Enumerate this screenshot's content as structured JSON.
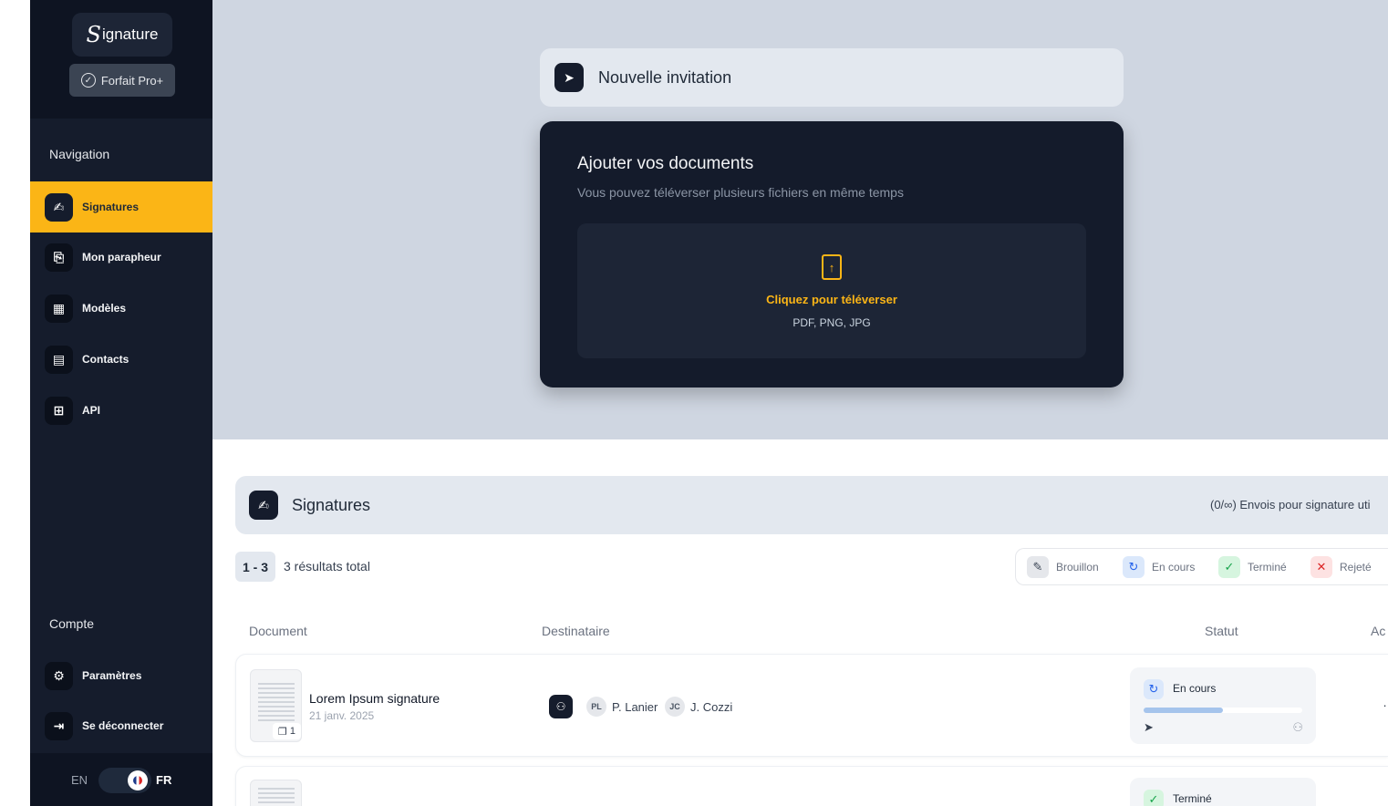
{
  "sidebar": {
    "logo": {
      "initial": "S",
      "rest": "ignature"
    },
    "plan": "Forfait Pro+",
    "navigation_title": "Navigation",
    "nav_items": [
      {
        "label": "Signatures",
        "icon": "signature-icon",
        "glyph": "✍"
      },
      {
        "label": "Mon parapheur",
        "icon": "parapheur-icon",
        "glyph": "⎘"
      },
      {
        "label": "Modèles",
        "icon": "templates-icon",
        "glyph": "▦"
      },
      {
        "label": "Contacts",
        "icon": "contacts-icon",
        "glyph": "▤"
      },
      {
        "label": "API",
        "icon": "api-icon",
        "glyph": "⊞"
      }
    ],
    "account_title": "Compte",
    "account_items": [
      {
        "label": "Paramètres",
        "icon": "gear-icon",
        "glyph": "⚙"
      },
      {
        "label": "Se déconnecter",
        "icon": "logout-icon",
        "glyph": "⇥"
      }
    ],
    "lang": {
      "left": "EN",
      "right": "FR",
      "active": "FR"
    }
  },
  "invite": {
    "title": "Nouvelle invitation",
    "upload_title": "Ajouter vos documents",
    "upload_subtitle": "Vous pouvez téléverser plusieurs fichiers en même temps",
    "dropzone_cta": "Cliquez pour téléverser",
    "dropzone_types": "PDF, PNG, JPG"
  },
  "signatures": {
    "title": "Signatures",
    "quota": "(0/∞) Envois pour signature uti",
    "range": "1 - 3",
    "results_total": "3 résultats total",
    "filters": [
      {
        "label": "Brouillon",
        "color": "#e5e7eb",
        "fg": "#374151",
        "glyph": "✎"
      },
      {
        "label": "En cours",
        "color": "#dbe8fb",
        "fg": "#2563eb",
        "glyph": "↻"
      },
      {
        "label": "Terminé",
        "color": "#d6f5df",
        "fg": "#16a34a",
        "glyph": "✓"
      },
      {
        "label": "Rejeté",
        "color": "#fde2e2",
        "fg": "#dc2626",
        "glyph": "✕"
      }
    ],
    "columns": {
      "document": "Document",
      "recipient": "Destinataire",
      "status": "Statut",
      "actions": "Ac"
    },
    "rows": [
      {
        "name": "Lorem Ipsum signature",
        "date": "21 janv. 2025",
        "doc_count": "1",
        "recipients": [
          {
            "initials": "PL",
            "name": "P. Lanier"
          },
          {
            "initials": "JC",
            "name": "J. Cozzi"
          }
        ],
        "status": "En cours",
        "progress": 0.5,
        "more": "…"
      },
      {
        "status": "Terminé"
      }
    ]
  }
}
